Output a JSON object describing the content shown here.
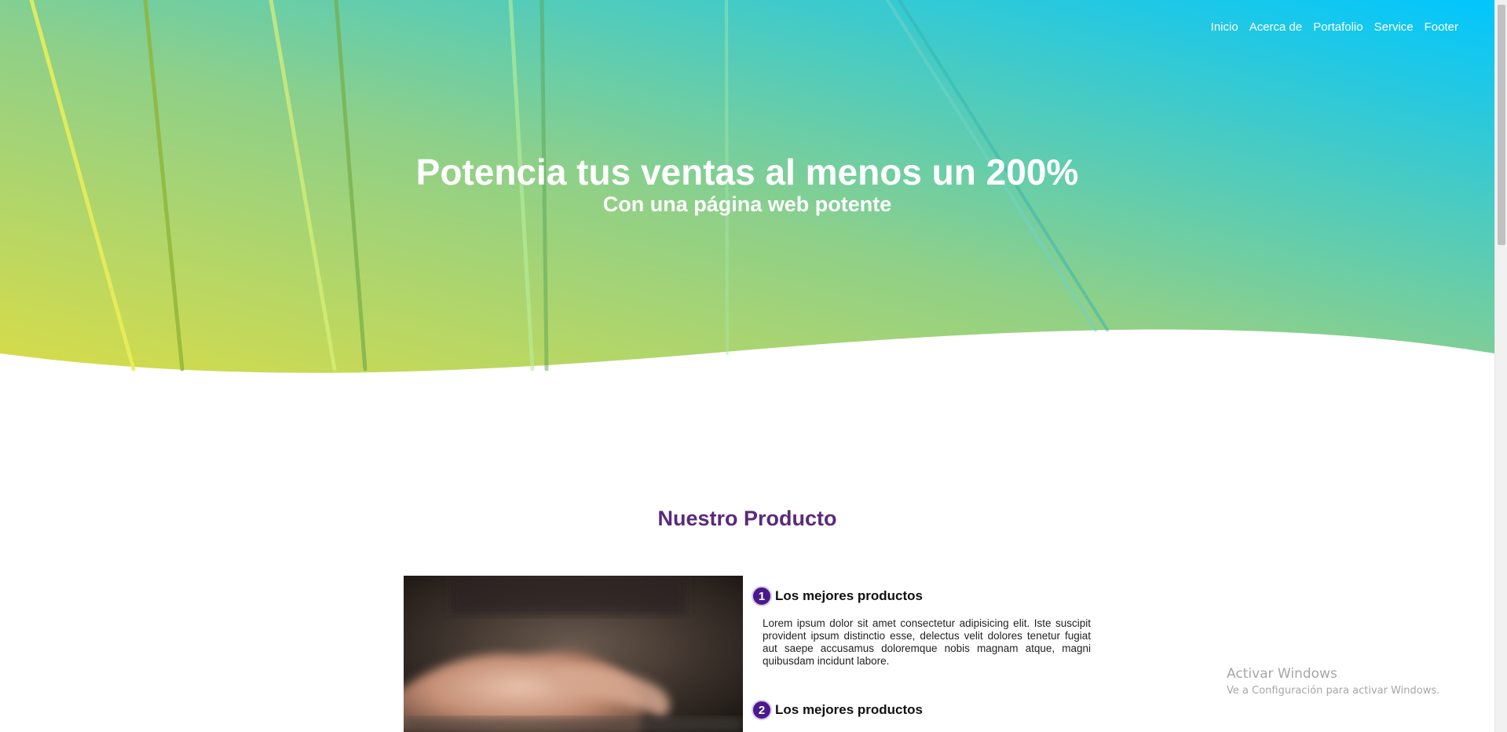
{
  "nav": {
    "items": [
      "Inicio",
      "Acerca de",
      "Portafolio",
      "Service",
      "Footer"
    ]
  },
  "hero": {
    "title": "Potencia tus ventas al menos un 200%",
    "subtitle": "Con una página web potente",
    "gradient_start": "#d6da4a",
    "gradient_mid": "#8ed08a",
    "gradient_end": "#02c8fb"
  },
  "product": {
    "section_title": "Nuestro Producto",
    "features": [
      {
        "number": "1",
        "title": "Los mejores productos",
        "text": "Lorem ipsum dolor sit amet consectetur adipisicing elit. Iste suscipit provident ipsum distinctio esse, delectus velit dolores tenetur fugiat aut saepe accusamus doloremque nobis magnam atque, magni quibusdam incidunt labore."
      },
      {
        "number": "2",
        "title": "Los mejores productos"
      }
    ]
  },
  "watermark": {
    "title": "Activar Windows",
    "subtitle": "Ve a Configuración para activar Windows."
  },
  "colors": {
    "section_title": "#5a2a7a",
    "badge": "#4a1a8c"
  }
}
